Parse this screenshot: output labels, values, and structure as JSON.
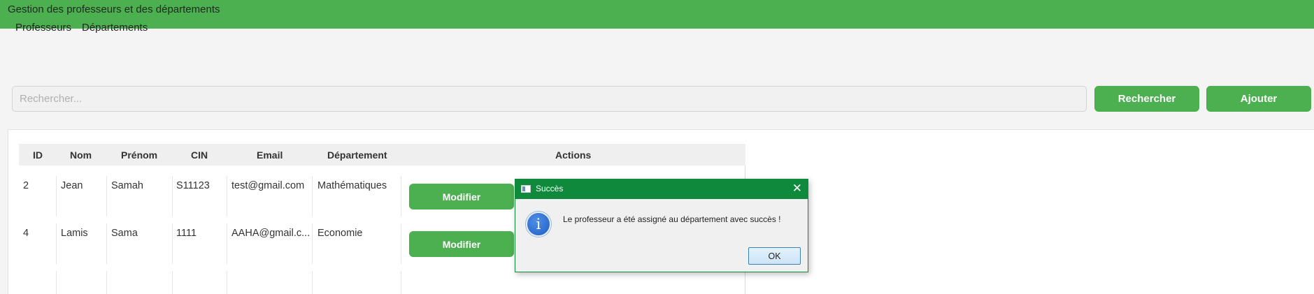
{
  "header": {
    "title": "Gestion des professeurs et des départements"
  },
  "menu": {
    "items": [
      "Professeurs",
      "Départements"
    ]
  },
  "search": {
    "placeholder": "Rechercher...",
    "value": ""
  },
  "buttons": {
    "search": "Rechercher",
    "add": "Ajouter"
  },
  "table": {
    "columns": [
      "ID",
      "Nom",
      "Prénom",
      "CIN",
      "Email",
      "Département",
      "Actions"
    ],
    "rows": [
      {
        "id": "2",
        "nom": "Jean",
        "prenom": "Samah",
        "cin": "S11123",
        "email": "test@gmail.com",
        "departement": "Mathématiques",
        "action": "Modifier"
      },
      {
        "id": "4",
        "nom": "Lamis",
        "prenom": "Sama",
        "cin": "1111",
        "email": "AAHA@gmail.c...",
        "departement": "Economie",
        "action": "Modifier"
      }
    ]
  },
  "dialog": {
    "title": "Succès",
    "message": "Le professeur a été assigné au département avec succès !",
    "ok": "OK",
    "icon": "info-icon"
  },
  "colors": {
    "accent": "#4caf50",
    "dialog_titlebar": "#0f8a3c"
  }
}
